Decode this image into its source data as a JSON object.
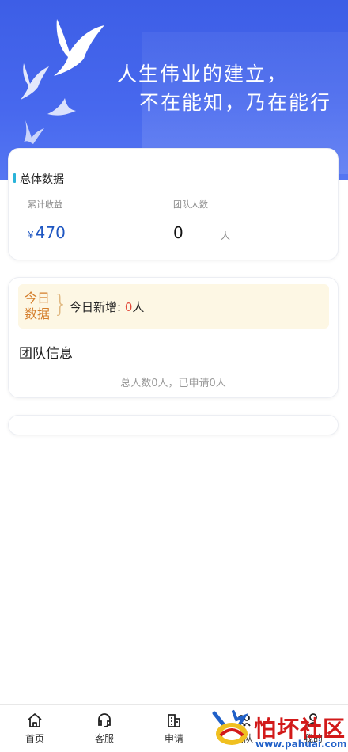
{
  "banner": {
    "slogan_line1": "人生伟业的建立，",
    "slogan_line2": "不在能知，乃在能行"
  },
  "overview": {
    "title": "总体数据",
    "earnings_label": "累计收益",
    "currency": "¥",
    "earnings_value": "470",
    "team_label": "团队人数",
    "team_value": "0",
    "team_unit": "人"
  },
  "today": {
    "tag_line1": "今日",
    "tag_line2": "数据",
    "new_prefix": "今日新增: ",
    "new_count": "0",
    "new_unit": "人"
  },
  "team_info": {
    "title": "团队信息",
    "summary": "总人数0人，已申请0人"
  },
  "tabbar": [
    {
      "label": "首页",
      "icon": "home-icon"
    },
    {
      "label": "客服",
      "icon": "headset-icon"
    },
    {
      "label": "申请",
      "icon": "building-icon"
    },
    {
      "label": "团队",
      "icon": "team-icon"
    },
    {
      "label": "我的",
      "icon": "user-icon"
    }
  ],
  "watermark": {
    "title": "怕坏社区",
    "url": "www.pahuai.com"
  },
  "colors": {
    "banner": "#4768ee",
    "money": "#1f57c2",
    "accent_bar": "#2ab3d9",
    "today_bg": "#fdf7e4",
    "today_tag": "#d47d2a",
    "highlight": "#e24a3a"
  }
}
